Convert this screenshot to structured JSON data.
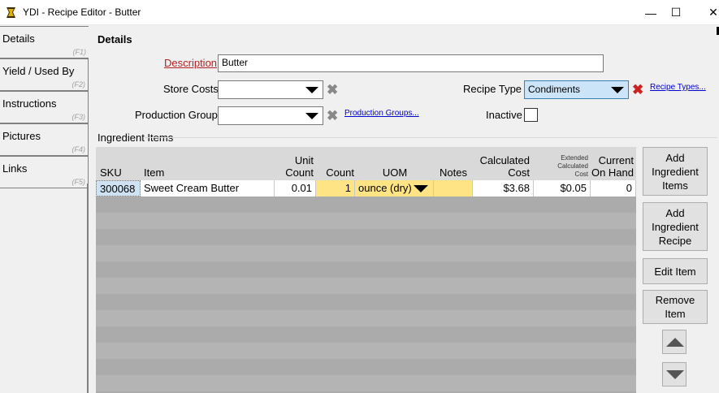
{
  "window": {
    "title": "YDI - Recipe Editor - Butter",
    "minimize_glyph": "—",
    "maximize_glyph": "☐",
    "close_glyph": "✕"
  },
  "tabs": [
    {
      "label": "Details",
      "key": "(F1)"
    },
    {
      "label": "Yield / Used By",
      "key": "(F2)"
    },
    {
      "label": "Instructions",
      "key": "(F3)"
    },
    {
      "label": "Pictures",
      "key": "(F4)"
    },
    {
      "label": "Links",
      "key": "(F5)"
    }
  ],
  "details": {
    "section_title": "Details",
    "description_label": "Description",
    "description_value": "Butter",
    "store_costs_label": "Store Costs",
    "store_costs_value": "",
    "production_group_label": "Production Group",
    "production_group_value": "",
    "production_groups_link": "Production Groups...",
    "recipe_type_label": "Recipe Type",
    "recipe_type_value": "Condiments",
    "recipe_types_link": "Recipe Types...",
    "inactive_label": "Inactive",
    "inactive_checked": false
  },
  "ingredients": {
    "group_label": "Ingredient Items",
    "columns": {
      "sku": "SKU",
      "item": "Item",
      "unit_count_1": "Unit",
      "unit_count_2": "Count",
      "count": "Count",
      "uom": "UOM",
      "notes": "Notes",
      "calc_cost_1": "Calculated",
      "calc_cost_2": "Cost",
      "ext_cost_1": "Extended",
      "ext_cost_2": "Calculated",
      "ext_cost_3": "Cost",
      "on_hand_1": "Current",
      "on_hand_2": "On Hand"
    },
    "rows": [
      {
        "sku": "300068",
        "item": "Sweet Cream Butter",
        "unit_count": "0.01",
        "count": "1",
        "uom": "ounce (dry)",
        "notes": "",
        "calc_cost": "$3.68",
        "ext_cost": "$0.05",
        "on_hand": "0"
      }
    ]
  },
  "buttons": {
    "add_item_1": "Add",
    "add_item_2": "Ingredient",
    "add_item_3": "Items",
    "add_recipe_1": "Add",
    "add_recipe_2": "Ingredient",
    "add_recipe_3": "Recipe",
    "edit_item": "Edit Item",
    "remove_item_1": "Remove",
    "remove_item_2": "Item"
  },
  "colors": {
    "required_label": "#b22222",
    "delete_red": "#cc2222",
    "delete_gray": "#888888",
    "editable_cell": "#ffe486",
    "link": "#0000cc"
  }
}
